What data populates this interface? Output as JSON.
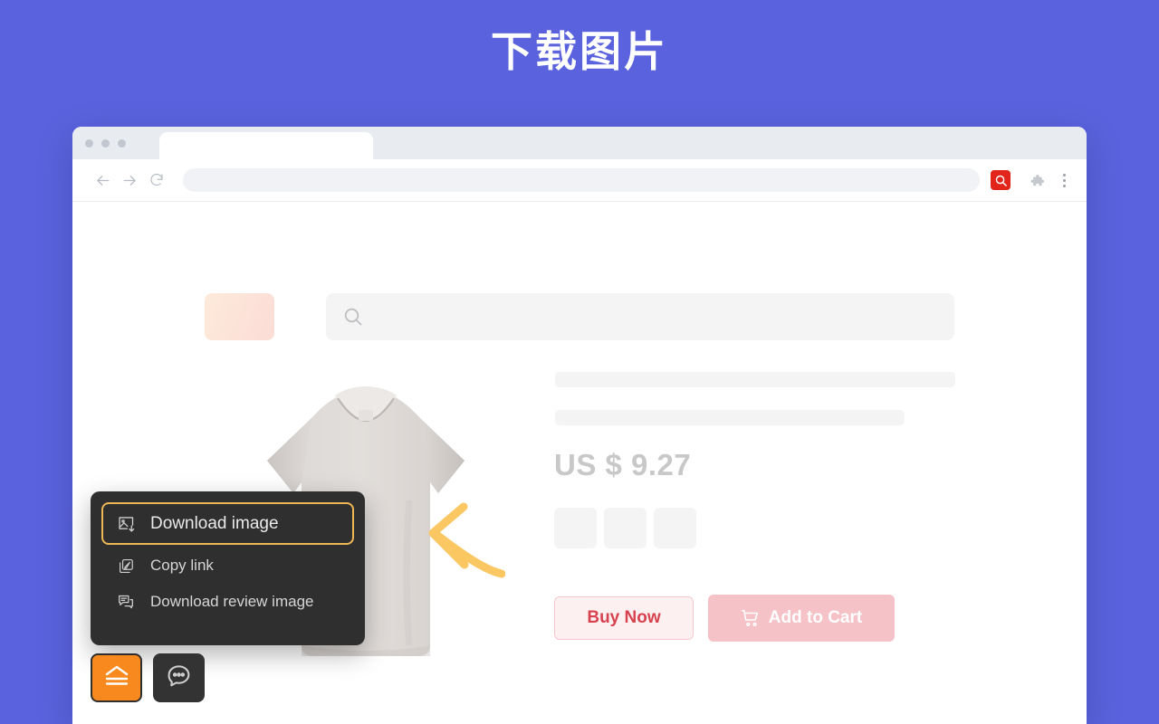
{
  "page": {
    "title": "下载图片",
    "background_color": "#5a63dd"
  },
  "browser": {
    "traffic_lights": [
      "dot",
      "dot",
      "dot"
    ],
    "tab": {
      "label": ""
    },
    "toolbar": {
      "back_icon": "arrow-left-icon",
      "forward_icon": "arrow-right-icon",
      "reload_icon": "reload-icon",
      "address_value": "",
      "address_placeholder": "",
      "extension_icon": "search-extension-icon",
      "extension_color": "#e1251b",
      "puzzle_icon": "puzzle-icon",
      "menu_icon": "kebab-menu-icon"
    }
  },
  "site": {
    "logo_placeholder": "",
    "search": {
      "icon": "search-icon",
      "value": "",
      "placeholder": ""
    },
    "product": {
      "image_alt": "gray t-shirt product photo",
      "title_placeholder_1": "",
      "title_placeholder_2": "",
      "price": "US $ 9.27",
      "swatches": [
        "",
        "",
        ""
      ],
      "buy_now_label": "Buy Now",
      "add_to_cart_label": "Add to Cart",
      "cart_icon": "shopping-cart-icon",
      "buy_now_color": "#d6434f",
      "add_to_cart_color": "#f5c2c7"
    }
  },
  "context_menu": {
    "background_color": "#2f2f2f",
    "highlight_color": "#eeb755",
    "items": [
      {
        "label": "Download image",
        "icon": "image-download-icon",
        "highlighted": true
      },
      {
        "label": "Copy link",
        "icon": "copy-link-icon",
        "highlighted": false
      },
      {
        "label": "Download review image",
        "icon": "review-image-icon",
        "highlighted": false
      }
    ]
  },
  "annotation": {
    "arrow_icon": "curved-arrow-left-icon",
    "arrow_color": "#fbc762"
  },
  "floating_buttons": [
    {
      "name": "upload-button",
      "icon": "eject-upload-icon",
      "color": "#f7891e"
    },
    {
      "name": "chat-button",
      "icon": "chat-bubble-icon",
      "color": "#333333"
    }
  ]
}
